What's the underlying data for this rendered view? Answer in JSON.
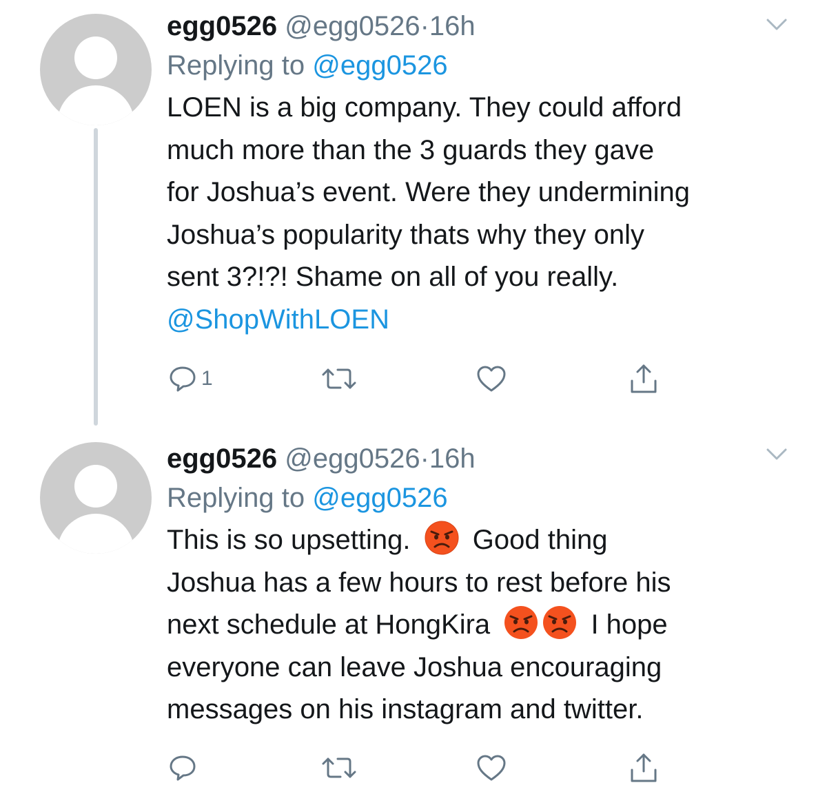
{
  "tweets": [
    {
      "display_name": "egg0526",
      "handle": "@egg0526",
      "separator": "·",
      "time": "16h",
      "replying_prefix": "Replying to",
      "replying_to": "@egg0526",
      "text_lines": [
        "LOEN is a big company. They could afford",
        "much more than the 3 guards they gave",
        "for Joshua’s event. Were they undermining",
        "Joshua’s popularity thats why they only",
        "sent 3?!?! Shame on all of you really."
      ],
      "mention_line": "@ShopWithLOEN",
      "actions": {
        "reply_count": "1",
        "retweet_count": "",
        "like_count": ""
      },
      "icons": [
        "reply-icon",
        "retweet-icon",
        "like-icon",
        "share-icon",
        "chevron-down-icon"
      ]
    },
    {
      "display_name": "egg0526",
      "handle": "@egg0526",
      "separator": "·",
      "time": "16h",
      "replying_prefix": "Replying to",
      "replying_to": "@egg0526",
      "text": {
        "line1_a": "This is so upsetting.",
        "line1_b": "Good thing",
        "line2": "Joshua has a few hours to rest before his",
        "line3_a": "next schedule at HongKira",
        "line3_b": "I hope",
        "line4": "everyone can leave Joshua encouraging",
        "line5": "messages on his instagram and twitter."
      },
      "emoji": "angry-face",
      "actions": {
        "reply_count": "",
        "retweet_count": "",
        "like_count": ""
      },
      "icons": [
        "reply-icon",
        "retweet-icon",
        "like-icon",
        "share-icon",
        "chevron-down-icon"
      ]
    }
  ],
  "colors": {
    "text": "#14171a",
    "secondary": "#657786",
    "link": "#1b95e0",
    "avatar": "#cccccc",
    "thread_line": "#cfd6dc",
    "emoji_face": "#f4511e"
  }
}
